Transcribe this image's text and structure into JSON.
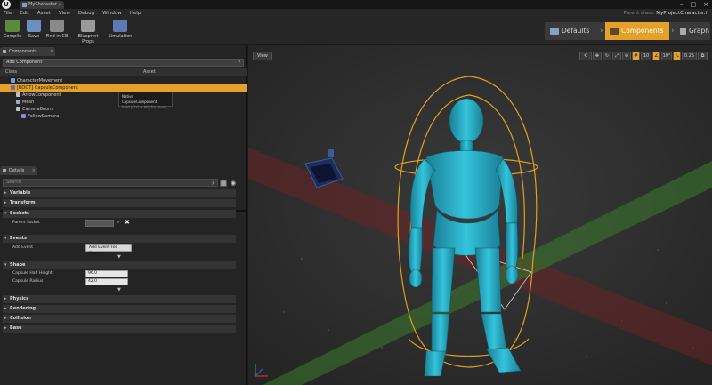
{
  "window": {
    "tab_title": "MyCharacter",
    "parent_class_label": "Parent class:",
    "parent_class_value": "MyProjectCharacter.h",
    "logo_text": "U"
  },
  "menu": [
    "File",
    "Edit",
    "Asset",
    "View",
    "Debug",
    "Window",
    "Help"
  ],
  "toolbar": {
    "buttons": [
      {
        "label": "Compile",
        "icon": "compile-icon",
        "color": "#5a8a3a"
      },
      {
        "label": "Save",
        "icon": "save-icon",
        "color": "#6a8fc0"
      },
      {
        "label": "Find in CB",
        "icon": "find-in-cb-icon",
        "color": "#8a8a8a"
      },
      {
        "label": "Blueprint Props",
        "icon": "gear-icon",
        "color": "#9a9a9a"
      },
      {
        "label": "Simulation",
        "icon": "play-icon",
        "color": "#5a7ab0"
      }
    ],
    "modes": [
      "Defaults",
      "Components",
      "Graph"
    ],
    "active_mode": "Components"
  },
  "components_panel": {
    "tab": "Components",
    "add_component": "Add Component",
    "col_class": "Class",
    "col_asset": "Asset",
    "tree": [
      {
        "label": "CharacterMovement",
        "indent": 1,
        "selected": false,
        "icon_color": "#7aa0d0"
      },
      {
        "label": "[ROOT] CapsuleComponent",
        "indent": 1,
        "selected": true,
        "icon_color": "#6a6ab0"
      },
      {
        "label": "ArrowComponent",
        "indent": 2,
        "selected": false,
        "icon_color": "#c0c0c0"
      },
      {
        "label": "Mesh",
        "indent": 2,
        "selected": false,
        "icon_color": "#9ab0c8"
      },
      {
        "label": "CameraBoom",
        "indent": 2,
        "selected": false,
        "icon_color": "#c0c0c0"
      },
      {
        "label": "FollowCamera",
        "indent": 3,
        "selected": false,
        "icon_color": "#8a8ad0"
      }
    ],
    "tooltip_title": "Native CapsuleComponent",
    "tooltip_sub": "hold (Ctrl + Alt) for more"
  },
  "details_panel": {
    "tab": "Details",
    "search_placeholder": "Search",
    "categories": {
      "variable": "Variable",
      "transform": "Transform",
      "sockets": "Sockets",
      "events": "Events",
      "shape": "Shape",
      "physics": "Physics",
      "rendering": "Rendering",
      "collision": "Collision",
      "base": "Base"
    },
    "parent_socket_label": "Parent Socket",
    "add_event_label": "Add Event",
    "add_event_button": "Add Event For Capsu",
    "capsule_half_height_label": "Capsule Half Height",
    "capsule_half_height_value": "96.0",
    "capsule_radius_label": "Capsule Radius",
    "capsule_radius_value": "42.0"
  },
  "viewport": {
    "view_button": "View",
    "tools": [
      {
        "label": "⟲",
        "icon": "transform-icon",
        "on": false
      },
      {
        "label": "✥",
        "icon": "translate-icon",
        "on": false
      },
      {
        "label": "↻",
        "icon": "rotate-icon",
        "on": false
      },
      {
        "label": "⤢",
        "icon": "scale-icon",
        "on": false
      },
      {
        "label": "⊕",
        "icon": "world-icon",
        "on": false
      },
      {
        "label": "#",
        "icon": "grid-snap-icon",
        "on": true
      },
      {
        "label": "10",
        "icon": "",
        "on": false
      },
      {
        "label": "∠",
        "icon": "angle-snap-icon",
        "on": true
      },
      {
        "label": "10°",
        "icon": "",
        "on": false
      },
      {
        "label": "⤡",
        "icon": "scale-snap-icon",
        "on": true
      },
      {
        "label": "0.25",
        "icon": "",
        "on": false
      },
      {
        "label": "⧉",
        "icon": "maximize-icon",
        "on": false
      }
    ],
    "colors": {
      "character": "#2ab0c8",
      "capsule": "#e0a020",
      "red_axis": "#7a2a2a",
      "green_axis": "#3a7a2a"
    }
  }
}
